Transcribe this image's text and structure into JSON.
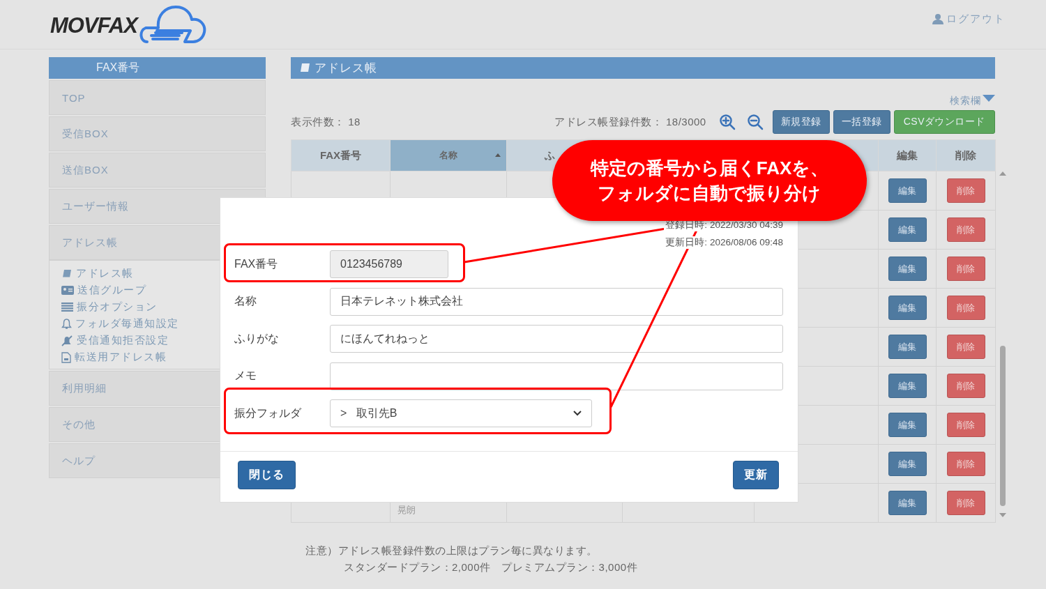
{
  "header": {
    "logo": "MOVFAX",
    "logout": "ログアウト"
  },
  "sidebar": {
    "title": "FAX番号",
    "items": [
      {
        "label": "TOP"
      },
      {
        "label": "受信BOX"
      },
      {
        "label": "送信BOX"
      },
      {
        "label": "ユーザー情報"
      },
      {
        "label": "アドレス帳",
        "children": [
          {
            "label": "アドレス帳"
          },
          {
            "label": "送信グループ"
          },
          {
            "label": "振分オプション"
          },
          {
            "label": "フォルダ毎通知設定"
          },
          {
            "label": "受信通知拒否設定"
          },
          {
            "label": "転送用アドレス帳"
          }
        ]
      },
      {
        "label": "利用明細"
      },
      {
        "label": "その他"
      },
      {
        "label": "ヘルプ"
      }
    ]
  },
  "main": {
    "title": "アドレス帳",
    "search_toggle": "検索欄",
    "count_label": "表示件数：",
    "count": "18",
    "registered_label": "アドレス帳登録件数：",
    "registered": "18/3000",
    "buttons": [
      {
        "label": "新規登録",
        "kind": "primary"
      },
      {
        "label": "一括登録",
        "kind": "primary"
      },
      {
        "label": "CSVダウンロード",
        "kind": "success"
      }
    ]
  },
  "table": {
    "columns": [
      {
        "label": "FAX番号",
        "sorted": false
      },
      {
        "label": "名称",
        "sorted": true
      },
      {
        "label": "ふ",
        "sorted": false
      },
      {
        "label": "編集",
        "sorted": false
      },
      {
        "label": "削除",
        "sorted": false
      }
    ],
    "rows": [
      {
        "edit": "編集",
        "delete": "削除"
      },
      {
        "edit": "編集",
        "delete": "削除"
      },
      {
        "edit": "編集",
        "delete": "削除"
      },
      {
        "edit": "編集",
        "delete": "削除"
      },
      {
        "edit": "編集",
        "delete": "削除"
      },
      {
        "edit": "編集",
        "delete": "削除"
      },
      {
        "edit": "編集",
        "delete": "削除"
      },
      {
        "edit": "編集",
        "delete": "削除"
      },
      {
        "name": "晃朗",
        "edit": "編集",
        "delete": "削除"
      }
    ]
  },
  "notes": [
    "注意）アドレス帳登録件数の上限はプラン毎に異なります。",
    "スタンダードプラン：2,000件　プレミアムプラン：3,000件"
  ],
  "dialog": {
    "meta": [
      {
        "label": "登録日時:",
        "value": "2022/03/30 04:39"
      },
      {
        "label": "更新日時:",
        "value": "2026/08/06 09:48"
      }
    ],
    "fields": [
      {
        "label": "FAX番号",
        "value": "0123456789",
        "kind": "readonly",
        "highlighted": true
      },
      {
        "label": "名称",
        "value": "日本テレネット株式会社",
        "kind": "text",
        "highlighted": false
      },
      {
        "label": "ふりがな",
        "value": "にほんてれねっと",
        "kind": "text",
        "highlighted": false
      },
      {
        "label": "メモ",
        "kind": "text",
        "highlighted": false
      },
      {
        "label": "振分フォルダ",
        "value": ">   取引先B",
        "kind": "select",
        "highlighted": true
      }
    ],
    "close": "閉じる",
    "update": "更新"
  },
  "callout": {
    "lines": [
      "特定の番号から届くFAXを、",
      "フォルダに自動で振り分け"
    ]
  }
}
